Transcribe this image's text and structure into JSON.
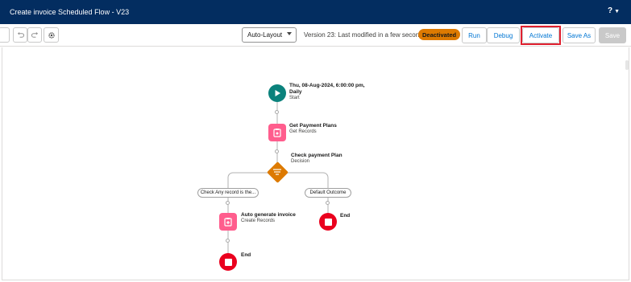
{
  "header": {
    "title": "Create invoice Scheduled Flow - V23",
    "help_label": "?",
    "help_caret": "▼"
  },
  "toolbar": {
    "layout_select_value": "Auto-Layout",
    "version_text": "Version 23: Last modified in a few seconds",
    "status_badge": "Deactivated",
    "run_label": "Run",
    "debug_label": "Debug",
    "activate_label": "Activate",
    "save_as_label": "Save As",
    "save_label": "Save",
    "icons": [
      "undo-icon",
      "redo-icon",
      "settings-icon"
    ]
  },
  "flow": {
    "start": {
      "title_line1": "Thu, 08-Aug-2024, 6:00:00 pm,",
      "title_line2": "Daily",
      "subtitle": "Start"
    },
    "get_records": {
      "title": "Get Payment Plans",
      "subtitle": "Get Records"
    },
    "decision": {
      "title": "Check payment Plan",
      "subtitle": "Decision"
    },
    "outcome_left": "Check Any record is the...",
    "outcome_right": "Default Outcome",
    "create_records": {
      "title": "Auto generate invoice",
      "subtitle": "Create Records"
    },
    "end_right": "End",
    "end_left": "End"
  },
  "colors": {
    "header_bg": "#032d60",
    "start_node": "#0b827c",
    "records_node": "#ff5d8d",
    "decision_node": "#dd7a01",
    "end_node": "#ea001e",
    "badge": "#dd7a01",
    "highlight_outline": "#e0202f"
  }
}
